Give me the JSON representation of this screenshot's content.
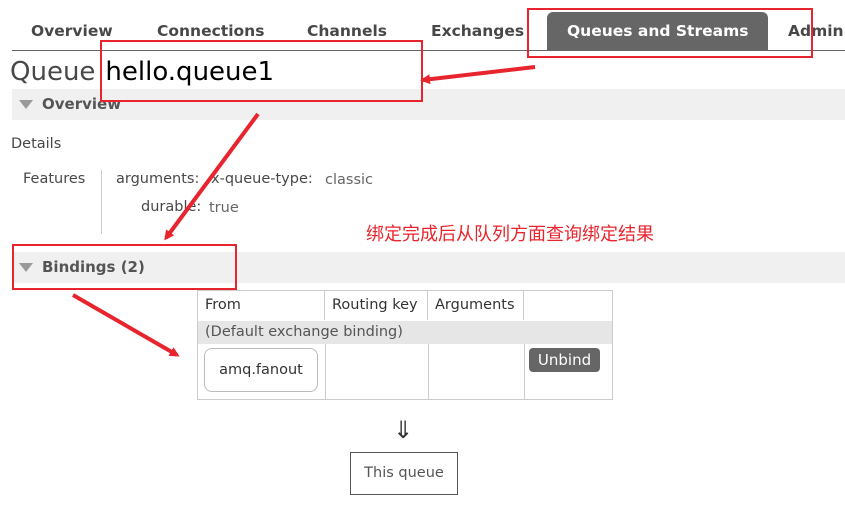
{
  "nav": {
    "tabs": [
      {
        "label": "Overview"
      },
      {
        "label": "Connections"
      },
      {
        "label": "Channels"
      },
      {
        "label": "Exchanges"
      },
      {
        "label": "Queues and Streams",
        "active": true
      },
      {
        "label": "Admin"
      }
    ]
  },
  "page": {
    "title_prefix": "Queue",
    "queue_name": "hello.queue1"
  },
  "overview": {
    "section_label": "Overview",
    "details_label": "Details",
    "features_label": "Features",
    "arguments_key": "arguments:",
    "queue_type_key": "x-queue-type:",
    "queue_type_value": "classic",
    "durable_key": "durable:",
    "durable_value": "true"
  },
  "bindings": {
    "section_label": "Bindings (2)",
    "columns": [
      "From",
      "Routing key",
      "Arguments",
      ""
    ],
    "default_binding_label": "(Default exchange binding)",
    "rows": [
      {
        "from": "amq.fanout",
        "routing_key": "",
        "arguments": "",
        "action": "Unbind"
      }
    ],
    "flow_arrow": "⇓",
    "this_queue_label": "This queue"
  },
  "annotation": {
    "note": "绑定完成后从队列方面查询绑定结果",
    "color": "#e8252e"
  }
}
